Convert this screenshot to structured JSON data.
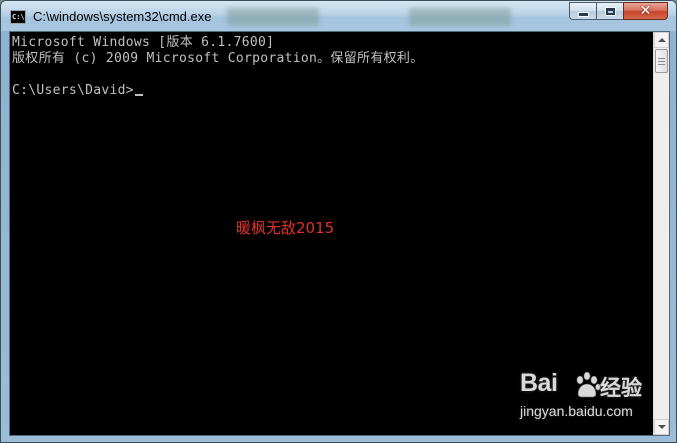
{
  "window": {
    "title": "C:\\windows\\system32\\cmd.exe",
    "icon": "cmd-icon",
    "icon_text": "C:\\"
  },
  "caption_buttons": {
    "minimize_icon": "minimize-icon",
    "maximize_icon": "maximize-icon",
    "close_icon": "close-icon",
    "close_glyph": "✕"
  },
  "console": {
    "lines": [
      "Microsoft Windows [版本 6.1.7600]",
      "版权所有 (c) 2009 Microsoft Corporation。保留所有权利。",
      "",
      "C:\\Users\\David>"
    ],
    "text_color": "#c0c0c0",
    "background": "#000000"
  },
  "overlay": {
    "watermark_text": "暖枫无敌2015",
    "watermark_color": "#e0302a"
  },
  "baidu_watermark": {
    "logo_text": "Bai",
    "logo_suffix": "经验",
    "url": "jingyan.baidu.com",
    "paw_icon": "baidu-paw-icon"
  },
  "scrollbar": {
    "up_icon": "scroll-up-icon",
    "down_icon": "scroll-down-icon"
  }
}
